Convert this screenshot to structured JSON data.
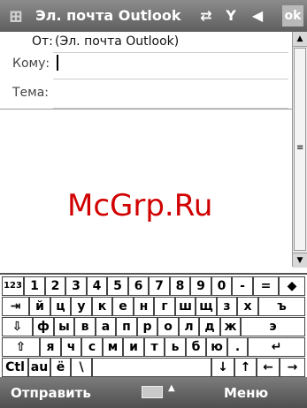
{
  "titlebar": {
    "start_glyph": "⊞",
    "title": "Эл. почта Outlook",
    "sync_glyph": "⇄",
    "signal_glyph": "Y",
    "volume_glyph": "◀",
    "ok_label": "ok"
  },
  "header": {
    "from_label": "От:",
    "from_value": "(Эл. почта Outlook)",
    "to_label": "Кому:",
    "to_value": "",
    "subject_label": "Тема:",
    "subject_value": ""
  },
  "scrollbar": {
    "up_glyph": "▲",
    "down_glyph": "▼",
    "grip_glyph": "≡"
  },
  "watermark": "McGrp.Ru",
  "keyboard": {
    "row1": [
      "123",
      "1",
      "2",
      "3",
      "4",
      "5",
      "6",
      "7",
      "8",
      "9",
      "0",
      "-",
      "=",
      "◆"
    ],
    "row2": [
      "⇥",
      "й",
      "ц",
      "у",
      "к",
      "е",
      "н",
      "г",
      "ш",
      "щ",
      "з",
      "х",
      "ъ"
    ],
    "row3": [
      "⇩",
      "ф",
      "ы",
      "в",
      "а",
      "п",
      "р",
      "о",
      "л",
      "д",
      "ж",
      "э"
    ],
    "row4": [
      "⇧",
      "я",
      "ч",
      "с",
      "м",
      "и",
      "т",
      "ь",
      "б",
      "ю",
      ".",
      "↵"
    ],
    "row5": [
      "Ctl",
      "au",
      "ё",
      "\\",
      "",
      "↓",
      "↑",
      "←",
      "→"
    ]
  },
  "menubar": {
    "left_label": "Отправить",
    "input_icon": "keyboard-icon",
    "input_arrow": "▲",
    "right_label": "Меню"
  }
}
